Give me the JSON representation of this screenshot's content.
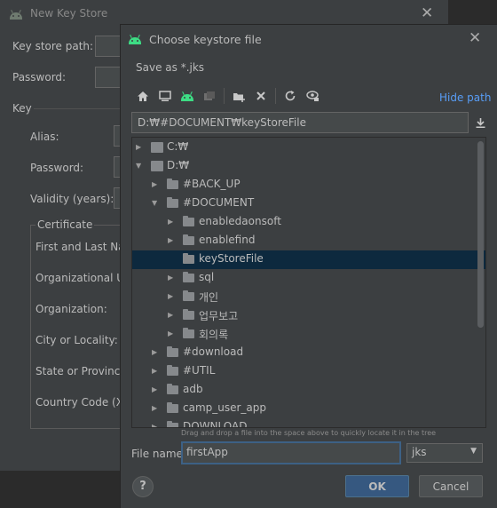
{
  "bg_window": {
    "title": "New Key Store",
    "keystore_path_label": "Key store path:",
    "password_label": "Password:",
    "key_section": "Key",
    "alias_label": "Alias:",
    "key_password_label": "Password:",
    "validity_label": "Validity (years):",
    "certificate_legend": "Certificate",
    "cert_fields": [
      "First and Last Nar",
      "Organizational Ur",
      "Organization:",
      "City or Locality:",
      "State or Province:",
      "Country Code (XX"
    ]
  },
  "dialog": {
    "title": "Choose keystore file",
    "save_as": "Save as *.jks",
    "hide_path": "Hide path",
    "path_value": "D:₩#DOCUMENT₩keyStoreFile",
    "tree": [
      {
        "label": "C:₩",
        "expanded": false,
        "drive": true
      },
      {
        "label": "D:₩",
        "expanded": true,
        "drive": true
      },
      {
        "label": "#BACK_UP",
        "expanded": false
      },
      {
        "label": "#DOCUMENT",
        "expanded": true
      },
      {
        "label": "enabledaonsoft",
        "expanded": false
      },
      {
        "label": "enablefind",
        "expanded": false
      },
      {
        "label": "keyStoreFile",
        "selected": true
      },
      {
        "label": "sql",
        "expanded": false
      },
      {
        "label": "개인",
        "expanded": false
      },
      {
        "label": "업무보고",
        "expanded": false
      },
      {
        "label": "회의록",
        "expanded": false
      },
      {
        "label": "#download",
        "expanded": false
      },
      {
        "label": "#UTIL",
        "expanded": false
      },
      {
        "label": "adb",
        "expanded": false
      },
      {
        "label": "camp_user_app",
        "expanded": false
      },
      {
        "label": "DOWNLOAD",
        "expanded": false
      }
    ],
    "hint": "Drag and drop a file into the space above to quickly locate it in the tree",
    "filename_label": "File name:",
    "filename_value": "firstApp",
    "extension": "jks",
    "help": "?",
    "ok": "OK",
    "cancel": "Cancel"
  },
  "colors": {
    "android_green": "#3ddc84",
    "link_blue": "#589df6",
    "selection": "#0d293e",
    "ok_button": "#365880"
  }
}
